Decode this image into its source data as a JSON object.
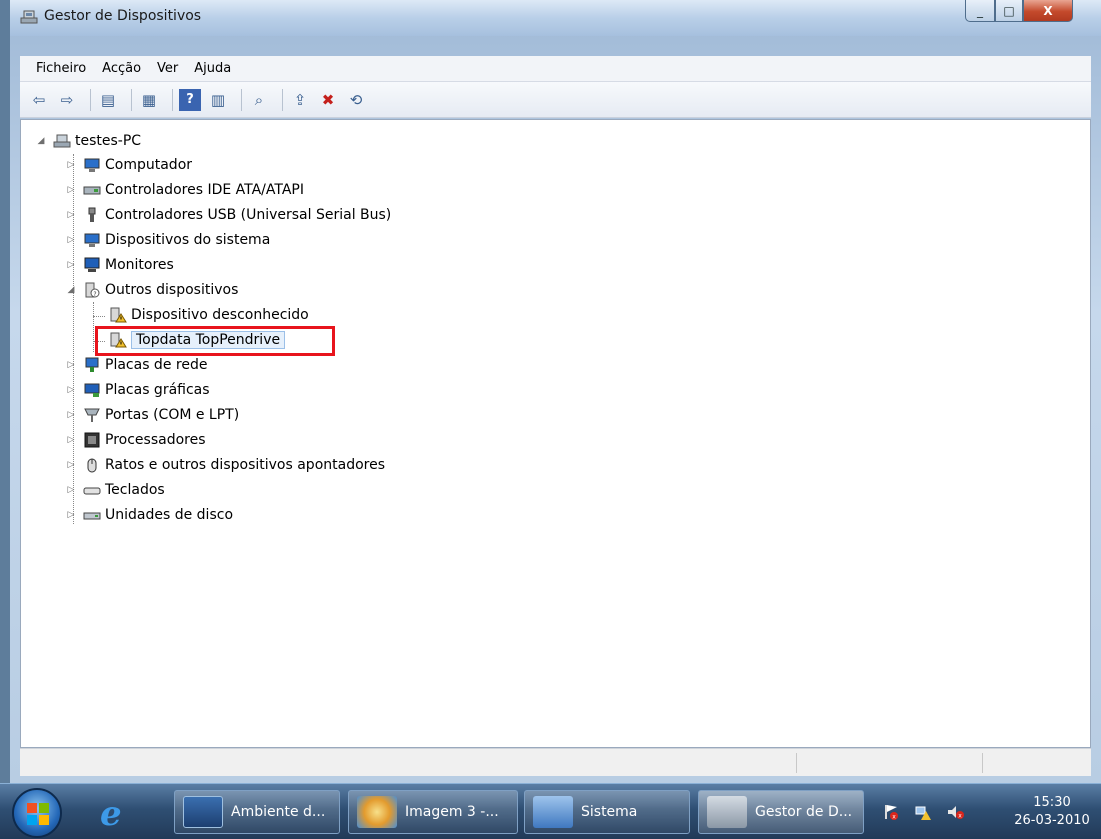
{
  "window": {
    "title": "Gestor de Dispositivos",
    "controls": {
      "minimize": "_",
      "maximize": "□",
      "close": "X"
    }
  },
  "menu": [
    "Ficheiro",
    "Acção",
    "Ver",
    "Ajuda"
  ],
  "toolbar": {
    "icons": [
      "back-arrow-icon",
      "forward-arrow-icon",
      "console-tree-icon",
      "properties-icon",
      "help-icon",
      "action-pane-icon",
      "scan-hardware-icon",
      "update-driver-icon",
      "disable-device-icon",
      "uninstall-device-icon"
    ]
  },
  "tree": {
    "root": "testes-PC",
    "categories": [
      "Computador",
      "Controladores IDE ATA/ATAPI",
      "Controladores USB (Universal Serial Bus)",
      "Dispositivos do sistema",
      "Monitores",
      "Outros dispositivos",
      "Placas de rede",
      "Placas gráficas",
      "Portas (COM e LPT)",
      "Processadores",
      "Ratos e outros dispositivos apontadores",
      "Teclados",
      "Unidades de disco"
    ],
    "other_devices_children": [
      "Dispositivo desconhecido",
      "Topdata TopPendrive"
    ],
    "selected": "Topdata TopPendrive"
  },
  "taskbar": {
    "buttons": [
      "Ambiente d...",
      "Imagem 3 -...",
      "Sistema",
      "Gestor de D..."
    ],
    "clock": {
      "time": "15:30",
      "date": "26-03-2010"
    }
  },
  "colors": {
    "highlight": "#e8141c",
    "warning": "#f2c12e"
  }
}
